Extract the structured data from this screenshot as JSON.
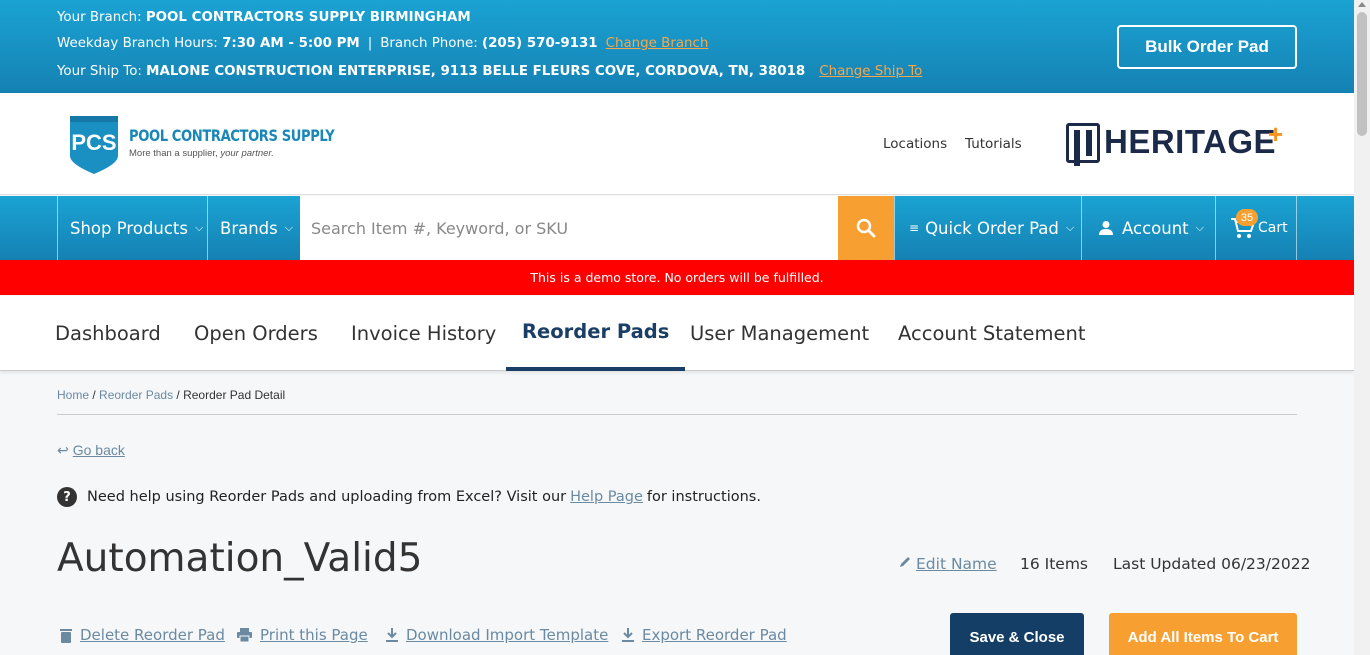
{
  "topbar": {
    "branch_label": "Your Branch: ",
    "branch_name": "POOL CONTRACTORS SUPPLY BIRMINGHAM",
    "hours_label": "Weekday Branch Hours: ",
    "hours_value": "7:30 AM - 5:00 PM",
    "separator": "|",
    "phone_label": "Branch Phone: ",
    "phone_value": "(205) 570-9131",
    "change_branch": "Change Branch",
    "shipto_label": "Your Ship To: ",
    "shipto_value": "MALONE CONSTRUCTION ENTERPRISE, 9113 BELLE FLEURS COVE, CORDOVA, TN, 38018",
    "change_shipto": "Change Ship To",
    "bulk_order": "Bulk Order Pad"
  },
  "header": {
    "logo_initials": "PCS",
    "logo_title": "POOL CONTRACTORS SUPPLY",
    "logo_tagline_a": "More than a supplier, ",
    "logo_tagline_b": "your partner.",
    "locations": "Locations",
    "tutorials": "Tutorials",
    "heritage": "HERITAGE",
    "heritage_plus": "+"
  },
  "nav": {
    "shop_products": "Shop Products",
    "brands": "Brands",
    "search_placeholder": "Search Item #, Keyword, or SKU",
    "quick_order": "Quick Order Pad",
    "account": "Account",
    "cart": "Cart",
    "cart_count": "35"
  },
  "demo_banner": "This is a demo store. No orders will be fulfilled.",
  "tabs": {
    "dashboard": "Dashboard",
    "open_orders": "Open Orders",
    "invoice_history": "Invoice History",
    "reorder_pads": "Reorder Pads",
    "user_management": "User Management",
    "account_statement": "Account Statement"
  },
  "breadcrumb": {
    "home": "Home",
    "sep": " / ",
    "reorder_pads": "Reorder Pads",
    "current": "Reorder Pad Detail"
  },
  "go_back": "Go back",
  "help": {
    "icon": "?",
    "text_before": "Need help using Reorder Pads and uploading from Excel? Visit our",
    "link": "Help Page",
    "text_after": "for instructions."
  },
  "pad": {
    "title": "Automation_Valid5",
    "edit_name": "Edit Name",
    "items": "16 Items",
    "last_updated": "Last Updated 06/23/2022"
  },
  "actions": {
    "delete": "Delete Reorder Pad",
    "print": "Print this Page",
    "download": "Download Import Template",
    "export": "Export Reorder Pad",
    "save_close": "Save & Close",
    "add_all": "Add All Items To Cart"
  },
  "colors": {
    "brand_blue": "#1a8fc2",
    "accent_orange": "#f7a031",
    "navy": "#143e66",
    "demo_red": "#ff0000"
  }
}
